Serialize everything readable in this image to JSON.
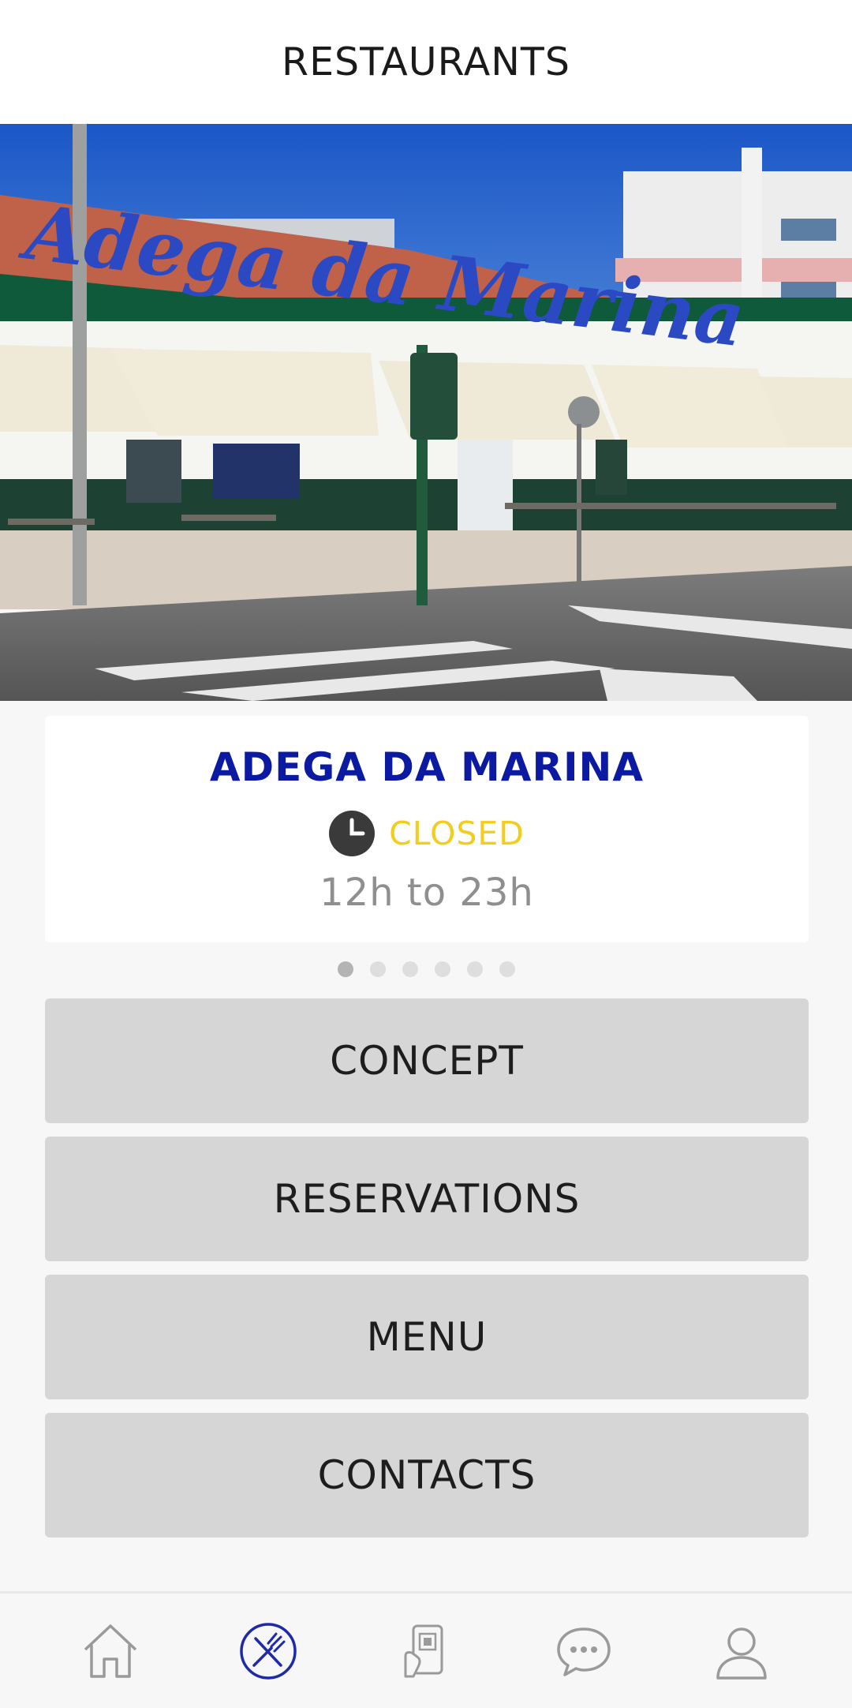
{
  "header": {
    "title": "RESTAURANTS"
  },
  "restaurant": {
    "name": "ADEGA DA MARINA",
    "status": "CLOSED",
    "hours": "12h to 23h",
    "status_color": "#f4cc1c",
    "name_color": "#0b1aa0"
  },
  "carousel": {
    "count": 6,
    "active_index": 0
  },
  "buttons": [
    {
      "label": "CONCEPT"
    },
    {
      "label": "RESERVATIONS"
    },
    {
      "label": "MENU"
    },
    {
      "label": "CONTACTS"
    }
  ],
  "nav": [
    {
      "icon": "home-icon"
    },
    {
      "icon": "restaurant-icon",
      "active": true
    },
    {
      "icon": "qr-phone-icon"
    },
    {
      "icon": "chat-icon"
    },
    {
      "icon": "profile-icon"
    }
  ]
}
